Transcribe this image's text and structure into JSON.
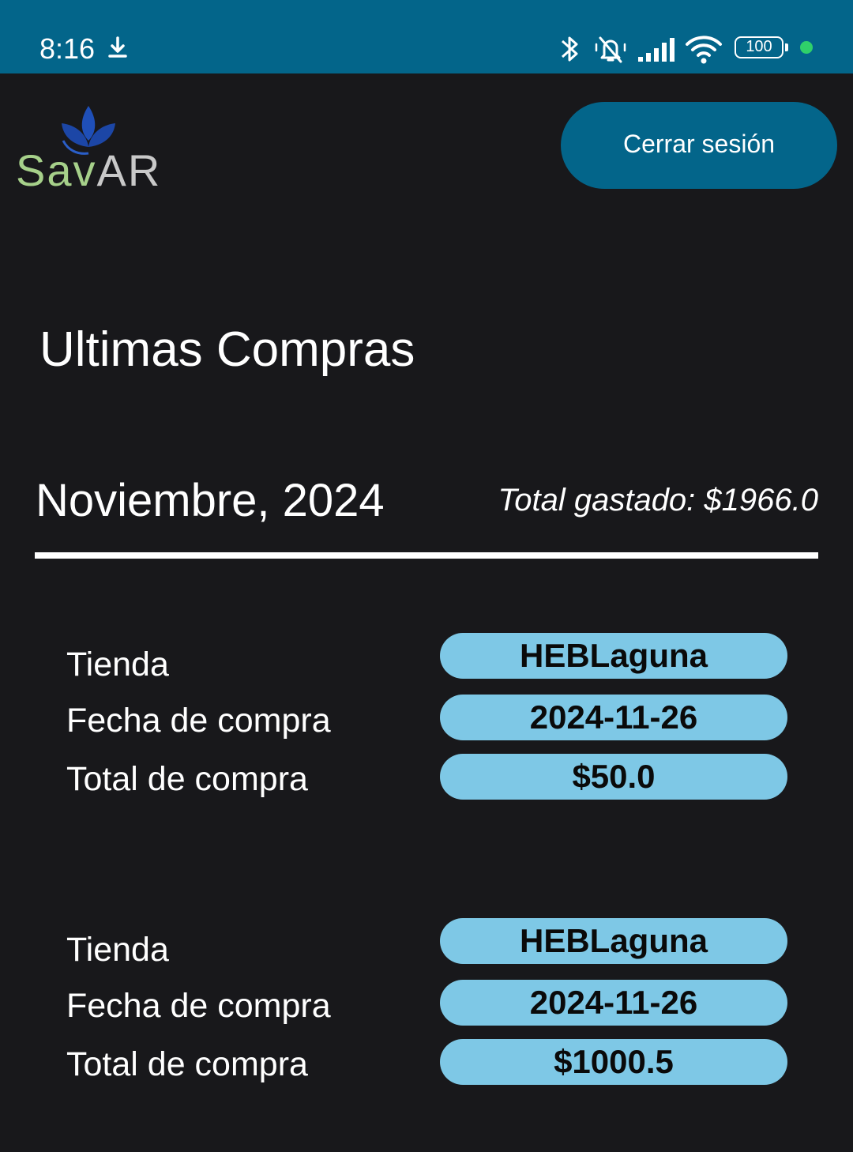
{
  "status_bar": {
    "time": "8:16",
    "battery": "100",
    "icons": [
      "download-icon",
      "bluetooth-icon",
      "mute-icon",
      "signal-icon",
      "wifi-icon",
      "battery-icon"
    ],
    "bg_color": "#03658a",
    "dot_color": "#2fd06a"
  },
  "header": {
    "logo": {
      "part1": "Sav",
      "part2": "AR",
      "icon": "leaf-logo-icon"
    },
    "logout_label": "Cerrar sesión"
  },
  "main": {
    "title": "Ultimas Compras",
    "month": "Noviembre, 2024",
    "total_spent": "Total gastado: $1966.0",
    "field_labels": {
      "store": "Tienda",
      "date": "Fecha de compra",
      "total": "Total de compra"
    },
    "purchases": [
      {
        "store": "HEBLaguna",
        "date": "2024-11-26",
        "total": "$50.0"
      },
      {
        "store": "HEBLaguna",
        "date": "2024-11-26",
        "total": "$1000.5"
      }
    ]
  },
  "colors": {
    "background": "#18181b",
    "accent": "#03658a",
    "pill": "#7ec8e6"
  }
}
